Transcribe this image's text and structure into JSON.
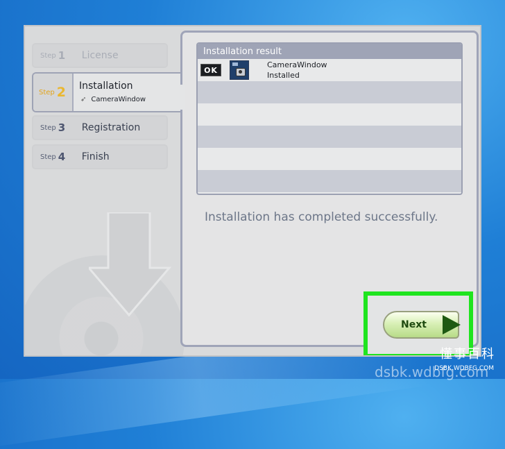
{
  "steps": [
    {
      "word": "Step",
      "num": "1",
      "label": "License",
      "state": "done"
    },
    {
      "word": "Step",
      "num": "2",
      "label": "Installation",
      "sub": "CameraWindow",
      "state": "current"
    },
    {
      "word": "Step",
      "num": "3",
      "label": "Registration",
      "state": "pending"
    },
    {
      "word": "Step",
      "num": "4",
      "label": "Finish",
      "state": "pending"
    }
  ],
  "result": {
    "header": "Installation result",
    "rows": [
      {
        "badge": "OK",
        "name": "CameraWindow",
        "status": "Installed"
      }
    ]
  },
  "message": "Installation has completed successfully.",
  "next_label": "Next",
  "watermark": {
    "cn": "懂事百科",
    "url": "DSBK.WDBFG.COM",
    "big": "dsbk.wdbfg.com"
  },
  "colors": {
    "highlight": "#1fe41f",
    "current_step_accent": "#eab730"
  }
}
